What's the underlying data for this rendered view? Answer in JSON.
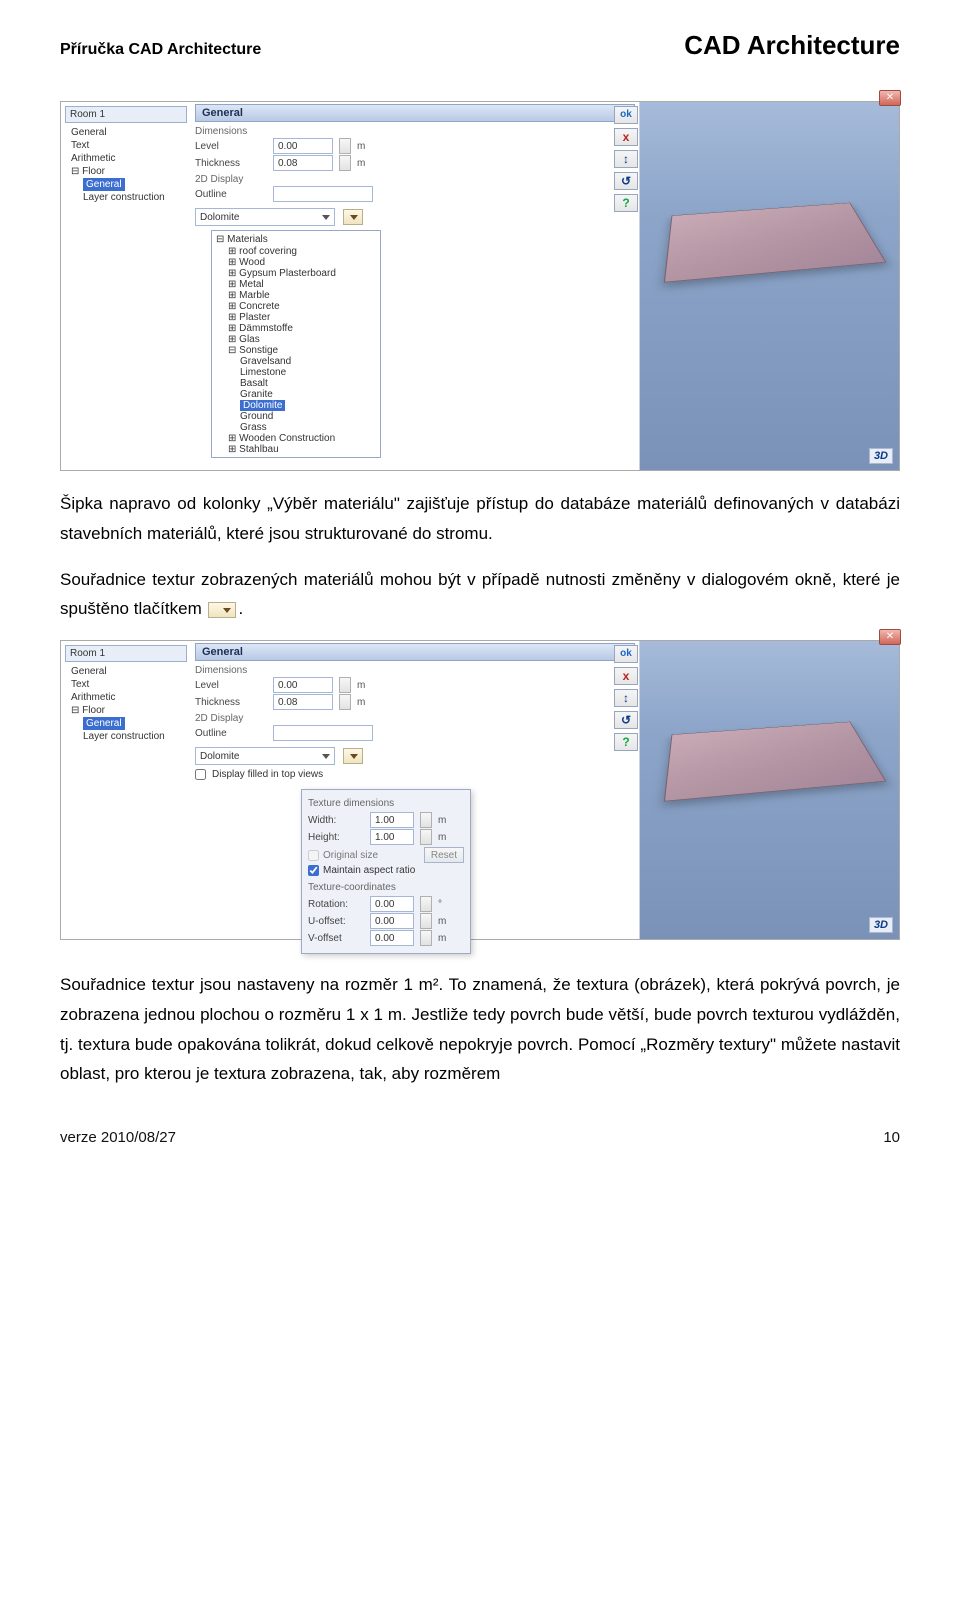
{
  "header": {
    "left": "Příručka CAD Architecture",
    "right": "CAD Architecture"
  },
  "footer": {
    "left": "verze 2010/08/27",
    "right": "10"
  },
  "body": {
    "p1": "Šipka napravo od kolonky „Výběr materiálu\" zajišťuje přístup do databáze materiálů definovaných v databázi stavebních materiálů, které jsou strukturované do stromu.",
    "p2a": "Souřadnice textur zobrazených materiálů mohou být v případě nutnosti změněny v dialogovém okně, které je spuštěno tlačítkem ",
    "p2b": ".",
    "p3": "Souřadnice textur jsou nastaveny na rozměr 1 m². To znamená, že textura (obrázek), která pokrývá povrch, je zobrazena jednou plochou o rozměru 1 x 1 m. Jestliže tedy povrch bude větší, bude povrch texturou vydlážděn, tj. textura bude opakována tolikrát, dokud celkově nepokryje povrch. Pomocí „Rozměry textury\" můžete nastavit oblast, pro kterou je textura zobrazena, tak, aby rozměrem"
  },
  "shot1": {
    "win_title": "Room 1",
    "tree": [
      "General",
      "Text",
      "Arithmetic",
      "Floor",
      "General",
      "Layer construction"
    ],
    "panel_title": "General",
    "dimensions_label": "Dimensions",
    "level_label": "Level",
    "level_value": "0.00",
    "thickness_label": "Thickness",
    "thickness_value": "0.08",
    "unit_m": "m",
    "disp2d_label": "2D Display",
    "outline_label": "Outline",
    "material_value": "Dolomite",
    "materials_header": "Materials",
    "materials": [
      "roof covering",
      "Wood",
      "Gypsum Plasterboard",
      "Metal",
      "Marble",
      "Concrete",
      "Plaster",
      "Dämmstoffe",
      "Glas",
      "Sonstige"
    ],
    "sonstige_children": [
      "Gravelsand",
      "Limestone",
      "Basalt",
      "Granite",
      "Dolomite",
      "Ground",
      "Grass"
    ],
    "materials_tail": [
      "Wooden Construction",
      "Stahlbau"
    ],
    "btns": {
      "ok": "ok",
      "x": "x",
      "q": "?"
    },
    "badge3d": "3D"
  },
  "shot2": {
    "win_title": "Room 1",
    "tree": [
      "General",
      "Text",
      "Arithmetic",
      "Floor",
      "General",
      "Layer construction"
    ],
    "panel_title": "General",
    "dimensions_label": "Dimensions",
    "level_label": "Level",
    "level_value": "0.00",
    "thickness_label": "Thickness",
    "thickness_value": "0.08",
    "unit_m": "m",
    "disp2d_label": "2D Display",
    "outline_label": "Outline",
    "material_value": "Dolomite",
    "display_filled_label": "Display filled in top views",
    "popup": {
      "sec1": "Texture dimensions",
      "width_label": "Width:",
      "width_value": "1.00",
      "height_label": "Height:",
      "height_value": "1.00",
      "orig_label": "Original size",
      "reset_label": "Reset",
      "aspect_label": "Maintain aspect ratio",
      "sec2": "Texture-coordinates",
      "rotation_label": "Rotation:",
      "rotation_value": "0.00",
      "rotation_unit": "°",
      "uoff_label": "U-offset:",
      "uoff_value": "0.00",
      "voff_label": "V-offset",
      "voff_value": "0.00"
    },
    "btns": {
      "ok": "ok",
      "x": "x",
      "q": "?"
    },
    "badge3d": "3D"
  }
}
